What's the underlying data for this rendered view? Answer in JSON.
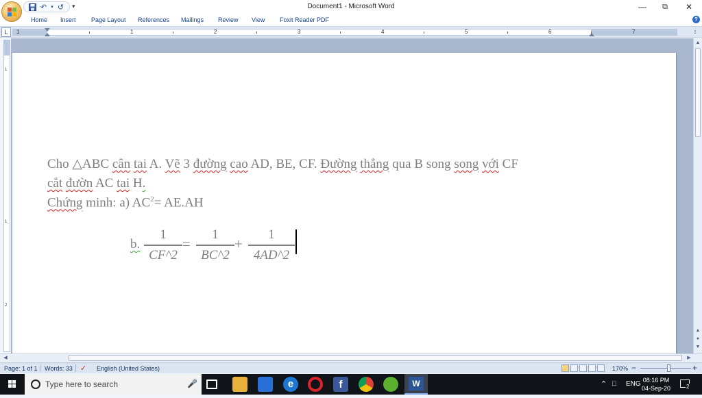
{
  "window": {
    "title": "Document1 - Microsoft Word",
    "minimize_icon": "minimize-icon",
    "restore_icon": "restore-icon",
    "close_icon": "close-icon"
  },
  "quick_access": {
    "icons": [
      "save-icon",
      "undo-icon",
      "redo-icon",
      "customize-dropdown-icon"
    ]
  },
  "ribbon": {
    "tabs": [
      "Home",
      "Insert",
      "Page Layout",
      "References",
      "Mailings",
      "Review",
      "View",
      "Foxit Reader PDF"
    ]
  },
  "ruler": {
    "numbers": [
      "1",
      "1",
      "2",
      "3",
      "4",
      "5",
      "6",
      "7"
    ],
    "tab_selector": "L"
  },
  "vertical_ruler": {
    "numbers": [
      "1",
      "1",
      "2"
    ]
  },
  "document": {
    "line1": {
      "parts": [
        "Cho △ABC ",
        "cân",
        " ",
        "tai",
        " A. ",
        "Vẽ",
        " 3 ",
        "đường",
        " ",
        "cao",
        " AD, BE, CF. ",
        "Đường",
        " ",
        "thẳng",
        " qua B song ",
        "song",
        " ",
        "với",
        " CF"
      ]
    },
    "line2": {
      "parts": [
        "cắt",
        " ",
        "đườn",
        " AC ",
        "tai",
        " H",
        "."
      ]
    },
    "line3": {
      "parts": [
        "Chứng",
        " minh: a) AC",
        "2",
        "= AE.AH"
      ]
    },
    "equation": {
      "prefix": "b.",
      "frac1": {
        "num": "1",
        "den": "CF^2"
      },
      "eq": "=",
      "frac2": {
        "num": "1",
        "den": "BC^2"
      },
      "plus": "+",
      "frac3": {
        "num": "1",
        "den": "4AD^2"
      }
    }
  },
  "status_bar": {
    "page": "Page: 1 of 1",
    "words": "Words: 33",
    "language": "English (United States)",
    "zoom": "170%",
    "zoom_minus": "−",
    "zoom_plus": "+"
  },
  "taskbar": {
    "search_placeholder": "Type here to search",
    "language": "ENG",
    "time": "08:16 PM",
    "date": "04-Sep-20",
    "notification_count": "2"
  }
}
